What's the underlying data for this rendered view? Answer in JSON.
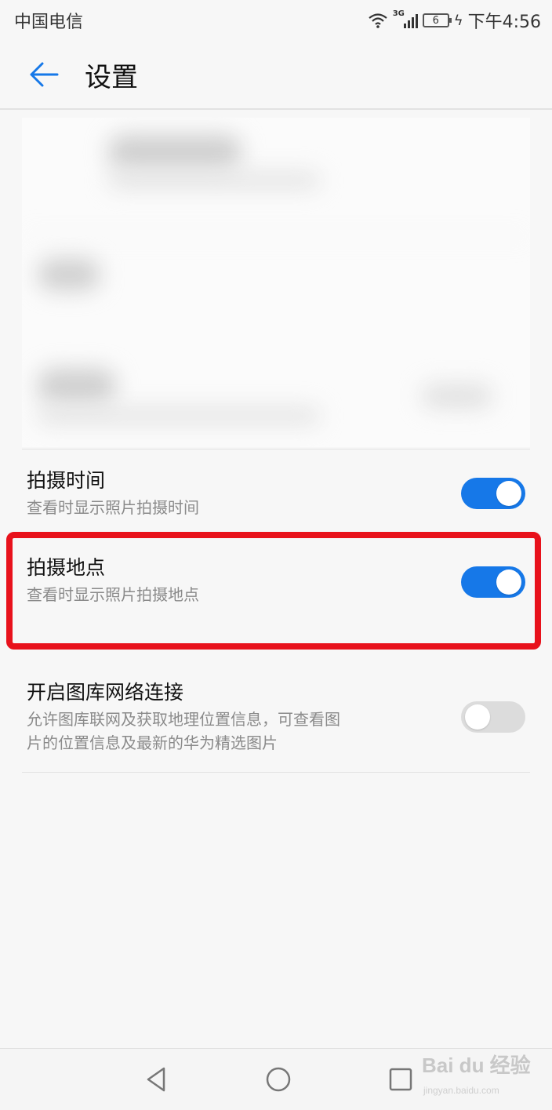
{
  "status_bar": {
    "carrier": "中国电信",
    "network_tag": "3G",
    "battery_level": "6",
    "time": "下午4:56"
  },
  "app_bar": {
    "title": "设置",
    "back_icon": "back-arrow-icon"
  },
  "settings": [
    {
      "title": "拍摄时间",
      "subtitle": "查看时显示照片拍摄时间",
      "enabled": true
    },
    {
      "title": "拍摄地点",
      "subtitle": "查看时显示照片拍摄地点",
      "enabled": true,
      "highlighted": true
    },
    {
      "title": "开启图库网络连接",
      "subtitle_line1": "允许图库联网及获取地理位置信息，可查看图",
      "subtitle_line2": "片的位置信息及最新的华为精选图片",
      "enabled": false
    }
  ],
  "colors": {
    "accent": "#1678e8",
    "highlight_border": "#e8121c",
    "toggle_off": "#dcdcdc"
  },
  "nav_bar": {
    "back_icon": "triangle-back-icon",
    "home_icon": "circle-home-icon",
    "recents_icon": "square-recents-icon"
  },
  "watermark": {
    "text": "Bai du 经验",
    "sub": "jingyan.baidu.com"
  }
}
